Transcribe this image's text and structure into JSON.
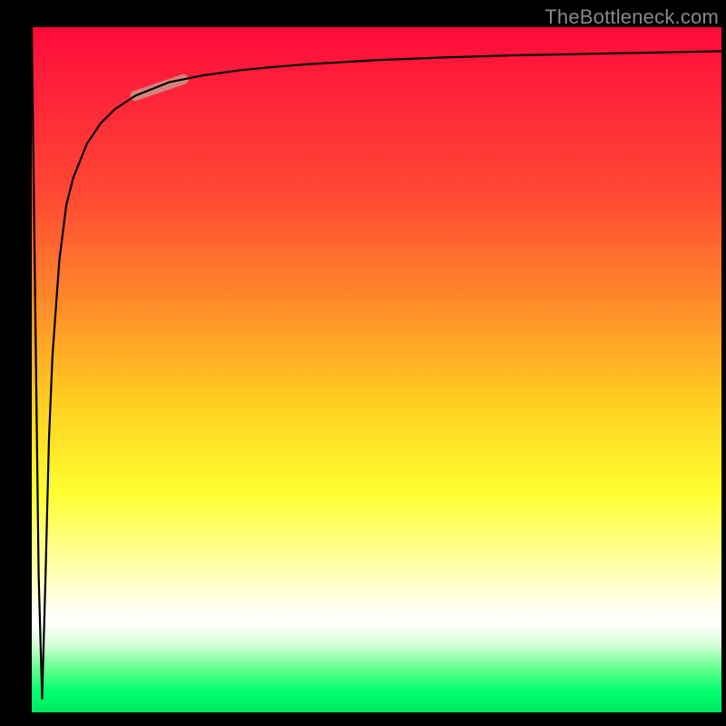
{
  "watermark": "TheBottleneck.com",
  "chart_data": {
    "type": "line",
    "title": "",
    "xlabel": "",
    "ylabel": "",
    "xlim": [
      0,
      100
    ],
    "ylim": [
      0,
      100
    ],
    "series": [
      {
        "name": "bottleneck-curve",
        "x": [
          0,
          0.5,
          1,
          1.5,
          2,
          2.5,
          3,
          4,
          5,
          6,
          8,
          10,
          12,
          15,
          20,
          25,
          30,
          35,
          40,
          50,
          60,
          70,
          80,
          90,
          100
        ],
        "values": [
          100,
          60,
          20,
          2,
          20,
          40,
          52,
          66,
          74,
          78,
          83,
          86,
          88,
          90,
          92,
          93,
          93.7,
          94.2,
          94.6,
          95.2,
          95.6,
          95.9,
          96.1,
          96.3,
          96.5
        ]
      }
    ],
    "highlight_segment": {
      "x_start": 15,
      "x_end": 22
    },
    "background_gradient": {
      "top": "#ff0a3a",
      "middle": "#ffff30",
      "bottom": "#00e860"
    }
  }
}
